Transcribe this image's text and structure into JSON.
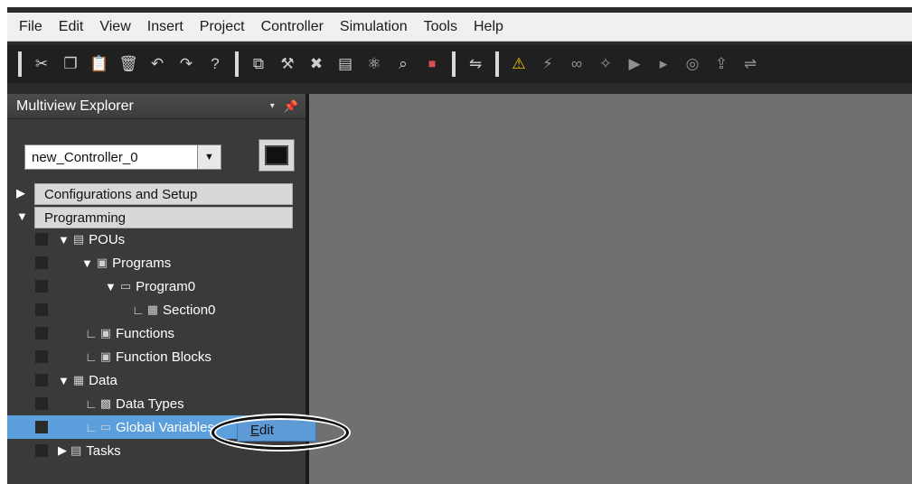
{
  "menu": [
    "File",
    "Edit",
    "View",
    "Insert",
    "Project",
    "Controller",
    "Simulation",
    "Tools",
    "Help"
  ],
  "toolbar": {
    "group1": [
      {
        "name": "cut-icon",
        "glyph": "✂"
      },
      {
        "name": "copy-icon",
        "glyph": "❐"
      },
      {
        "name": "paste-icon",
        "glyph": "📋"
      },
      {
        "name": "delete-icon",
        "glyph": "🗑"
      },
      {
        "name": "undo-icon",
        "glyph": "↶"
      },
      {
        "name": "redo-icon",
        "glyph": "↷"
      },
      {
        "name": "help-icon",
        "glyph": "?"
      }
    ],
    "group2": [
      {
        "name": "new-window-icon",
        "glyph": "⧉"
      },
      {
        "name": "build-icon",
        "glyph": "⚒"
      },
      {
        "name": "cross-reference-icon",
        "glyph": "✖"
      },
      {
        "name": "monitor-icon",
        "glyph": "▤"
      },
      {
        "name": "network-icon",
        "glyph": "⚛"
      },
      {
        "name": "search-icon",
        "glyph": "⌕"
      },
      {
        "name": "stop-icon",
        "glyph": "⏹"
      }
    ],
    "group3": [
      {
        "name": "online-icon",
        "glyph": "⇋"
      }
    ],
    "group4": [
      {
        "name": "warning-icon",
        "glyph": "⚠"
      },
      {
        "name": "offline-icon",
        "glyph": "⚡"
      },
      {
        "name": "watch-icon",
        "glyph": "∞"
      },
      {
        "name": "debug-icon",
        "glyph": "✧"
      },
      {
        "name": "step-icon",
        "glyph": "▶"
      },
      {
        "name": "step-over-icon",
        "glyph": "▸"
      },
      {
        "name": "reset-icon",
        "glyph": "◎"
      },
      {
        "name": "transfer-icon",
        "glyph": "⇪"
      },
      {
        "name": "compare-icon",
        "glyph": "⇌"
      }
    ]
  },
  "explorer": {
    "title": "Multiview Explorer",
    "pin": "📌",
    "dropdown": "▾",
    "controller": "new_Controller_0",
    "sections": {
      "config": "Configurations and Setup",
      "programming": "Programming"
    },
    "tree": {
      "pous": "POUs",
      "programs": "Programs",
      "program0": "Program0",
      "section0": "Section0",
      "functions": "Functions",
      "function_blocks": "Function Blocks",
      "data": "Data",
      "data_types": "Data Types",
      "global_variables": "Global Variables",
      "tasks": "Tasks"
    }
  },
  "context_menu": {
    "edit_underlined": "E",
    "edit_rest": "dit"
  },
  "colors": {
    "selection": "#5b9fdc",
    "editor_bg": "#707070",
    "panel_bg": "#3a3a3a"
  }
}
